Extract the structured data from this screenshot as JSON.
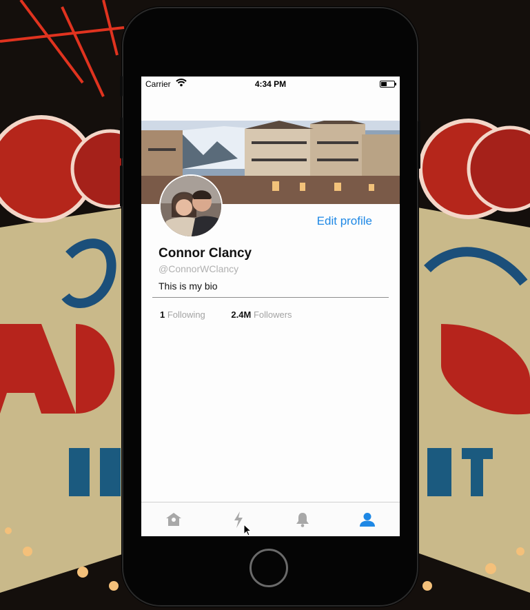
{
  "status_bar": {
    "carrier": "Carrier",
    "time": "4:34 PM",
    "battery_level": 0.45
  },
  "profile": {
    "edit_label": "Edit profile",
    "name": "Connor Clancy",
    "handle": "@ConnorWClancy",
    "bio": "This is my bio",
    "following_count": "1",
    "following_label": "Following",
    "followers_count": "2.4M",
    "followers_label": "Followers"
  },
  "tab_bar": {
    "tabs": [
      {
        "icon": "home-icon",
        "active": false
      },
      {
        "icon": "lightning-icon",
        "active": false
      },
      {
        "icon": "bell-icon",
        "active": false
      },
      {
        "icon": "person-icon",
        "active": true
      }
    ]
  },
  "colors": {
    "accent": "#1e88e5",
    "inactive_icon": "#a8a8a8",
    "secondary_text": "#a3a3a3"
  }
}
